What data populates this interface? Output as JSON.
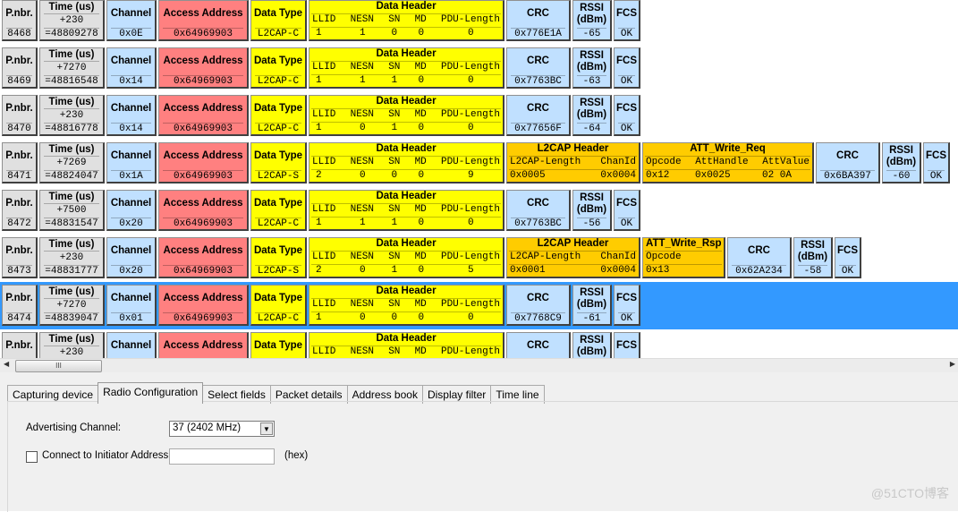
{
  "labels": {
    "pnbr": "P.nbr.",
    "time": "Time (us)",
    "channel": "Channel",
    "access": "Access Address",
    "dtype": "Data Type",
    "dheader": "Data Header",
    "dh_cols": [
      "LLID",
      "NESN",
      "SN",
      "MD",
      "PDU-Length"
    ],
    "l2cap": "L2CAP Header",
    "l2cap_cols": [
      "L2CAP-Length",
      "ChanId"
    ],
    "crc": "CRC",
    "rssi1": "RSSI",
    "rssi2": "(dBm)",
    "fcs": "FCS",
    "att_req": "ATT_Write_Req",
    "att_req_cols": [
      "Opcode",
      "AttHandle",
      "AttValue"
    ],
    "att_rsp": "ATT_Write_Rsp",
    "att_rsp_cols": [
      "Opcode"
    ]
  },
  "packets": [
    {
      "pnbr": "8468",
      "delta": "+230",
      "time": "=48809278",
      "channel": "0x0E",
      "access": "0x64969903",
      "dtype": "L2CAP-C",
      "dh": [
        "1",
        "1",
        "0",
        "0",
        "0"
      ],
      "crc": "0x776E1A",
      "rssi": "-65",
      "fcs": "OK"
    },
    {
      "pnbr": "8469",
      "delta": "+7270",
      "time": "=48816548",
      "channel": "0x14",
      "access": "0x64969903",
      "dtype": "L2CAP-C",
      "dh": [
        "1",
        "1",
        "1",
        "0",
        "0"
      ],
      "crc": "0x7763BC",
      "rssi": "-63",
      "fcs": "OK"
    },
    {
      "pnbr": "8470",
      "delta": "+230",
      "time": "=48816778",
      "channel": "0x14",
      "access": "0x64969903",
      "dtype": "L2CAP-C",
      "dh": [
        "1",
        "0",
        "1",
        "0",
        "0"
      ],
      "crc": "0x77656F",
      "rssi": "-64",
      "fcs": "OK"
    },
    {
      "pnbr": "8471",
      "delta": "+7269",
      "time": "=48824047",
      "channel": "0x1A",
      "access": "0x64969903",
      "dtype": "L2CAP-S",
      "dh": [
        "2",
        "0",
        "0",
        "0",
        "9"
      ],
      "l2cap": [
        "0x0005",
        "0x0004"
      ],
      "att": "req",
      "att_vals": [
        "0x12",
        "0x0025",
        "02 0A"
      ],
      "crc": "0x6BA397",
      "rssi": "-60",
      "fcs": "OK"
    },
    {
      "pnbr": "8472",
      "delta": "+7500",
      "time": "=48831547",
      "channel": "0x20",
      "access": "0x64969903",
      "dtype": "L2CAP-C",
      "dh": [
        "1",
        "1",
        "1",
        "0",
        "0"
      ],
      "crc": "0x7763BC",
      "rssi": "-56",
      "fcs": "OK"
    },
    {
      "pnbr": "8473",
      "delta": "+230",
      "time": "=48831777",
      "channel": "0x20",
      "access": "0x64969903",
      "dtype": "L2CAP-S",
      "dh": [
        "2",
        "0",
        "1",
        "0",
        "5"
      ],
      "l2cap": [
        "0x0001",
        "0x0004"
      ],
      "att": "rsp",
      "att_vals": [
        "0x13"
      ],
      "crc": "0x62A234",
      "rssi": "-58",
      "fcs": "OK"
    },
    {
      "pnbr": "8474",
      "delta": "+7270",
      "time": "=48839047",
      "channel": "0x01",
      "access": "0x64969903",
      "dtype": "L2CAP-C",
      "dh": [
        "1",
        "0",
        "0",
        "0",
        "0"
      ],
      "crc": "0x7768C9",
      "rssi": "-61",
      "fcs": "OK",
      "selected": true
    },
    {
      "pnbr": "",
      "delta": "+230",
      "time": "",
      "channel": "",
      "access": "",
      "dtype": "",
      "dh": [
        "",
        "",
        "",
        "",
        ""
      ],
      "crc": "",
      "rssi": "",
      "fcs": ""
    }
  ],
  "scrollbar": {
    "thumb_grip": "III"
  },
  "tabs": [
    "Capturing device",
    "Radio Configuration",
    "Select fields",
    "Packet details",
    "Address book",
    "Display filter",
    "Time line"
  ],
  "active_tab": "Radio Configuration",
  "radio": {
    "adv_label": "Advertising Channel:",
    "adv_value": "37 (2402 MHz)",
    "connect_label": "Connect to Initiator Address",
    "connect_checked": false,
    "address_value": "",
    "hex_label": "(hex)"
  },
  "watermark": "@51CTO博客",
  "colors": {
    "selection": "#3399ff",
    "gray": "#e0e0e0",
    "blue": "#c0e0ff",
    "red": "#ff8080",
    "yellow": "#ffff00",
    "orange": "#ffcc00"
  }
}
